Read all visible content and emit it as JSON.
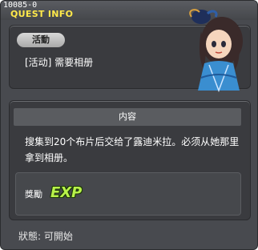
{
  "window": {
    "quest_id": "10085-0",
    "title": "QUEST INFO"
  },
  "header": {
    "category": "活動",
    "quest_name": "[活动] 需要相册"
  },
  "body": {
    "section_title": "内容",
    "description": "搜集到20个布片后交给了露迪米拉。必须从她那里拿到相册。",
    "reward_label": "獎勵",
    "reward_icon_text": "EXP"
  },
  "footer": {
    "status": "狀態: 可開始"
  },
  "icons": {
    "reward": "exp-icon",
    "npc": "npc-portrait"
  },
  "colors": {
    "title": "#ffe94a",
    "exp": "#b8f24a"
  }
}
